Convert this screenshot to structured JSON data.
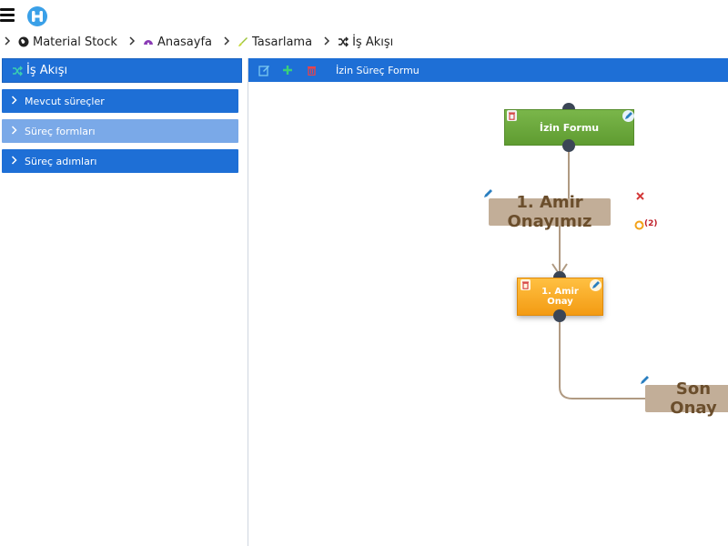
{
  "breadcrumb": {
    "items": [
      {
        "label": "Material Stock",
        "icon": "globe-icon"
      },
      {
        "label": "Anasayfa",
        "icon": "dashboard-icon"
      },
      {
        "label": "Tasarlama",
        "icon": "brush-icon"
      },
      {
        "label": "İş Akışı",
        "icon": "shuffle-icon"
      }
    ]
  },
  "sidebar": {
    "header": "İş Akışı",
    "items": [
      {
        "label": "Mevcut süreçler"
      },
      {
        "label": "Süreç formları"
      },
      {
        "label": "Süreç adımları"
      }
    ]
  },
  "toolbar": {
    "title": "İzin Süreç Formu"
  },
  "diagram": {
    "start_node": "İzin Formu",
    "label1": "1. Amir Onayımız",
    "task_node_line1": "1. Amir",
    "task_node_line2": "Onay",
    "label2": "Son Onay",
    "connection_count": "(2)"
  },
  "colors": {
    "primary": "#1e6fd6",
    "active_item": "#7aa9e8",
    "start_node": "#6aa83a",
    "task_node": "#f7a928",
    "label_node": "#c2ae98",
    "connector": "#b09a82",
    "port": "#3b4656"
  }
}
